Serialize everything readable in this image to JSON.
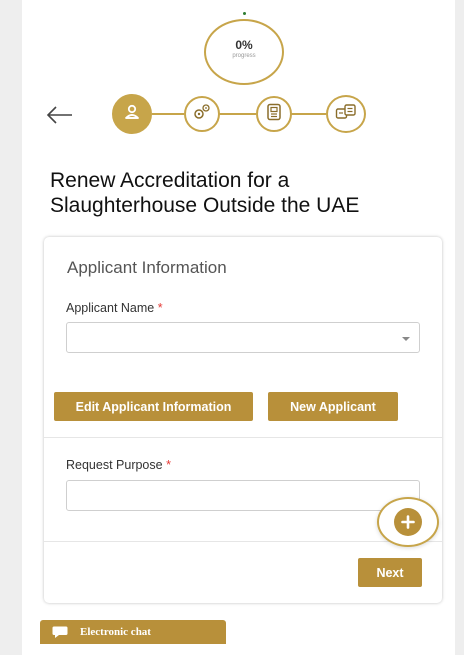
{
  "progress": {
    "value": "0%",
    "label": "progress"
  },
  "steps": [
    {
      "name": "applicant",
      "state": "active"
    },
    {
      "name": "services",
      "state": "pending"
    },
    {
      "name": "documents",
      "state": "pending"
    },
    {
      "name": "payment",
      "state": "pending"
    }
  ],
  "page": {
    "title_line1": "Renew Accreditation for a",
    "title_line2": "Slaughterhouse Outside the UAE"
  },
  "applicant_section": {
    "title": "Applicant Information",
    "name_label": "Applicant Name",
    "required_mark": "*",
    "name_value": "",
    "edit_button": "Edit Applicant Information",
    "new_button": "New Applicant"
  },
  "request_section": {
    "purpose_label": "Request Purpose",
    "required_mark": "*",
    "purpose_value": ""
  },
  "actions": {
    "next": "Next"
  },
  "chat": {
    "label": "Electronic chat"
  },
  "colors": {
    "accent": "#b8903a",
    "ring": "#c7a54a",
    "required": "#e53935"
  }
}
